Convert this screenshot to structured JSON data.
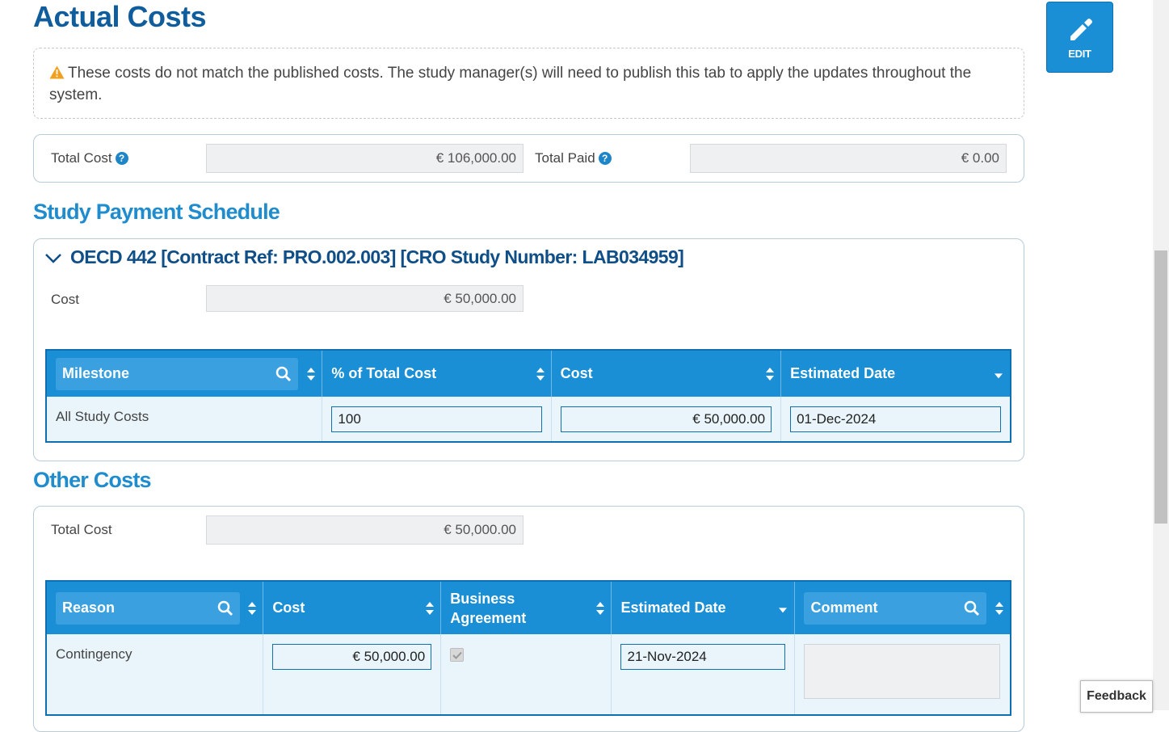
{
  "page": {
    "title": "Actual Costs",
    "edit_label": "EDIT",
    "warning_text": "These costs do not match the published costs. The study manager(s) will need to publish this tab to apply the updates throughout the system."
  },
  "totals": {
    "total_cost_label": "Total Cost",
    "total_cost_value": "€ 106,000.00",
    "total_paid_label": "Total Paid",
    "total_paid_value": "€ 0.00"
  },
  "payment_schedule": {
    "section_title": "Study Payment Schedule",
    "study_heading": "OECD 442 [Contract Ref: PRO.002.003] [CRO Study Number: LAB034959]",
    "cost_label": "Cost",
    "cost_value": "€ 50,000.00",
    "columns": [
      "Milestone",
      "% of Total Cost",
      "Cost",
      "Estimated Date"
    ],
    "rows": [
      {
        "milestone": "All Study Costs",
        "percent": "100",
        "cost": "€ 50,000.00",
        "date": "01-Dec-2024"
      }
    ]
  },
  "other_costs": {
    "section_title": "Other Costs",
    "total_cost_label": "Total Cost",
    "total_cost_value": "€ 50,000.00",
    "columns": [
      "Reason",
      "Cost",
      "Business Agreement",
      "Estimated Date",
      "Comment"
    ],
    "rows": [
      {
        "reason": "Contingency",
        "cost": "€ 50,000.00",
        "business_agreement": true,
        "date": "21-Nov-2024",
        "comment": ""
      }
    ]
  },
  "feedback_label": "Feedback",
  "colors": {
    "title": "#0f5d9c",
    "section": "#1f8ccd",
    "header_bg": "#1a8fd6",
    "row_bg": "#e9f4fb",
    "warning": "#f0a020"
  },
  "icons": [
    "pencil-icon",
    "warning-icon",
    "help-icon",
    "chevron-down-icon",
    "search-icon",
    "sort-icon",
    "sort-desc-icon"
  ]
}
